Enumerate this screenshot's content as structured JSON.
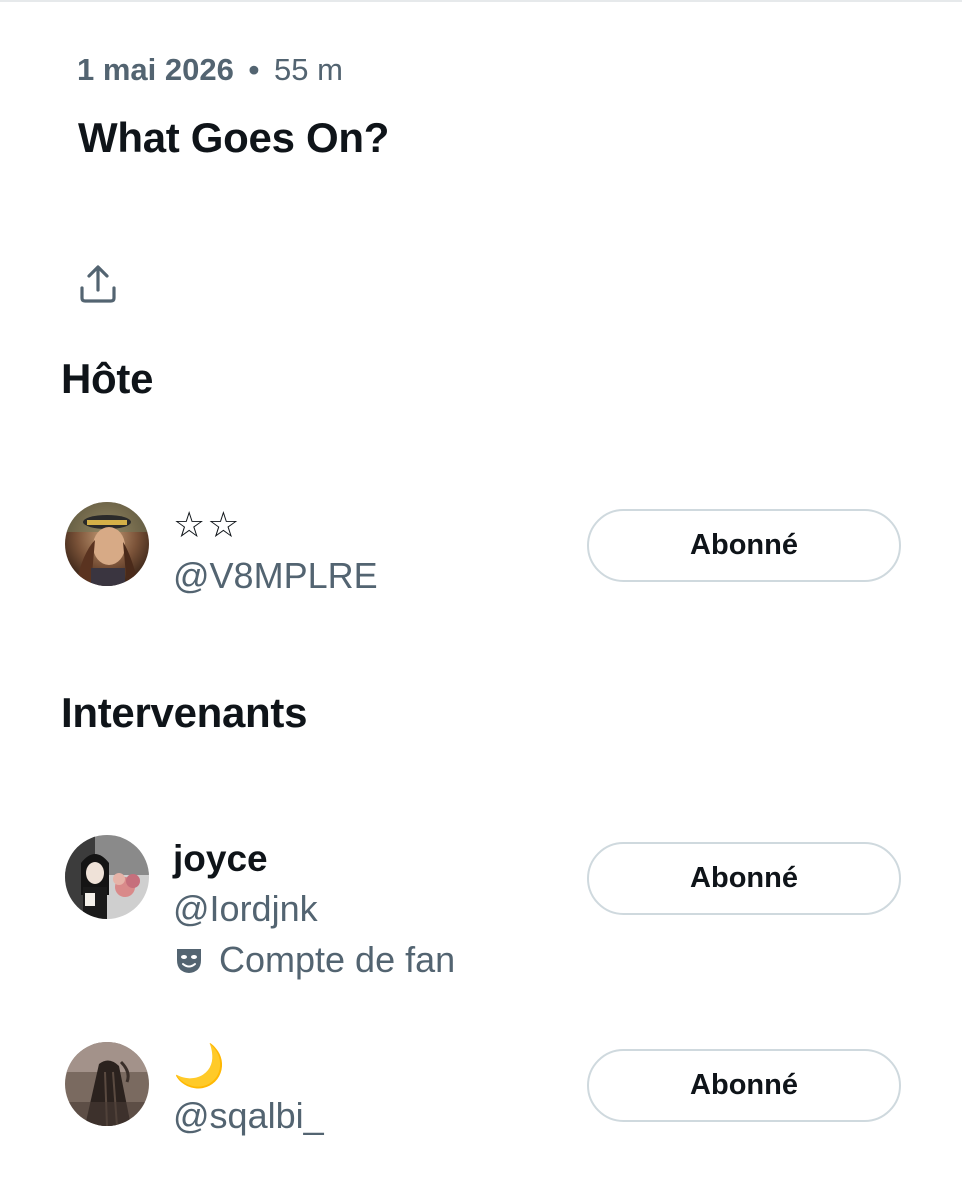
{
  "space": {
    "date": "1 mai 2026",
    "separator": "•",
    "duration": "55 m",
    "title": "What Goes On?"
  },
  "icons": {
    "share": "share-upload-icon",
    "fan_label": "theater-mask-icon"
  },
  "colors": {
    "text_primary": "#0f1419",
    "text_secondary": "#536471",
    "button_border": "#cfd9de",
    "moon": "#f2c14e"
  },
  "host_section": {
    "title": "Hôte",
    "users": [
      {
        "display_name": "☆☆",
        "handle": "@V8MPLRE",
        "button_label": "Abonné"
      }
    ]
  },
  "speakers_section": {
    "title": "Intervenants",
    "users": [
      {
        "display_name": "joyce",
        "handle": "@Iordjnk",
        "label": "Compte de fan",
        "button_label": "Abonné"
      },
      {
        "display_name": "🌙",
        "handle": "@sqalbi_",
        "button_label": "Abonné"
      }
    ]
  }
}
